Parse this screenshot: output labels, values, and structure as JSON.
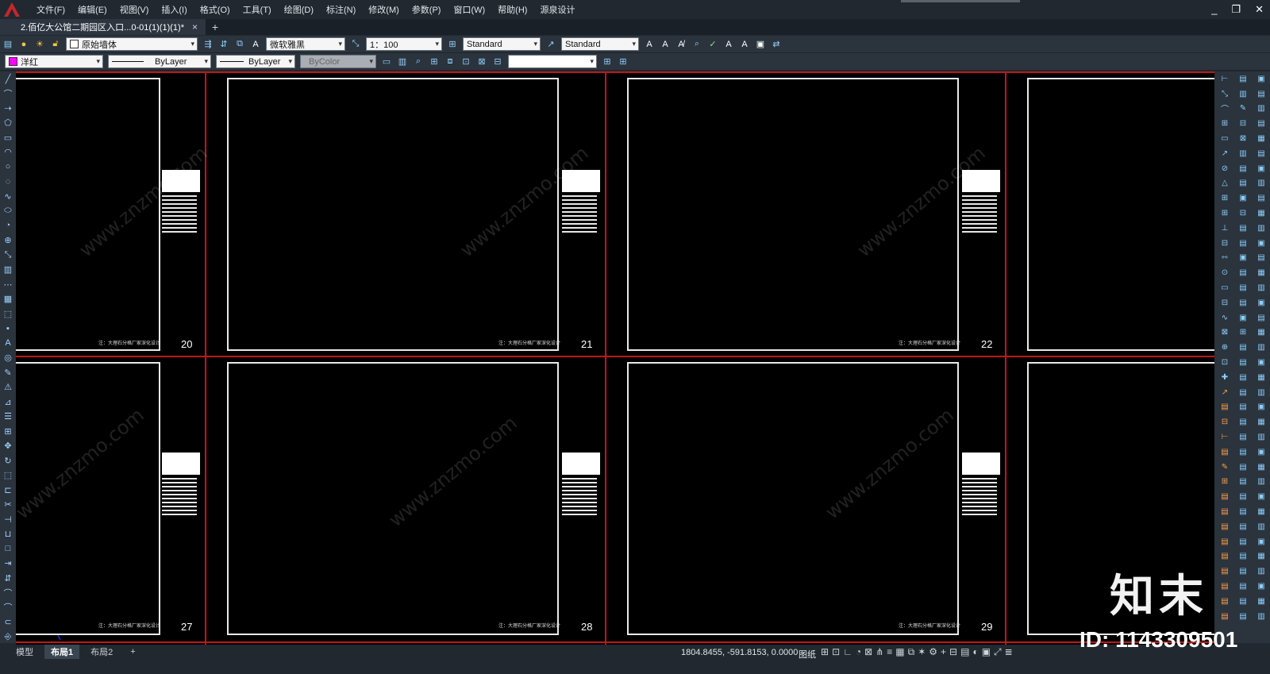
{
  "menu": [
    "文件(F)",
    "编辑(E)",
    "视图(V)",
    "插入(I)",
    "格式(O)",
    "工具(T)",
    "绘图(D)",
    "标注(N)",
    "修改(M)",
    "参数(P)",
    "窗口(W)",
    "帮助(H)",
    "源泉设计"
  ],
  "doc_tab": {
    "title": "2.佰亿大公馆二期园区入口...0-01(1)(1)(1)*",
    "close": "×",
    "add": "+"
  },
  "toolbar1": {
    "layer": "原始墙体",
    "text_style": "微软雅黑",
    "scale": "1：100",
    "dim_style": "Standard",
    "table_style": "Standard"
  },
  "toolbar2": {
    "color_name": "洋红",
    "color_hex": "#ff00ff",
    "linetype": "ByLayer",
    "lineweight": "ByLayer",
    "plotstyle": "ByColor",
    "input_value": ""
  },
  "sheets": [
    {
      "number": "20",
      "note": "注：大理石分格厂家深化设计"
    },
    {
      "number": "21",
      "note": "注：大理石分格厂家深化设计"
    },
    {
      "number": "22",
      "note": "注：大理石分格厂家深化设计"
    },
    {
      "number": "27",
      "note": "注：大理石分格厂家深化设计"
    },
    {
      "number": "28",
      "note": "注：大理石分格厂家深化设计"
    },
    {
      "number": "29",
      "note": "注：大理石分格厂家深化设计"
    }
  ],
  "layout_tabs": [
    "模型",
    "布局1",
    "布局2",
    "+"
  ],
  "status": {
    "coords": "1804.8455, -591.8153, 0.0000",
    "paper": "图纸"
  },
  "watermark": "www.znzmo.com",
  "brand": {
    "name": "知末",
    "id": "ID: 1143309501"
  }
}
